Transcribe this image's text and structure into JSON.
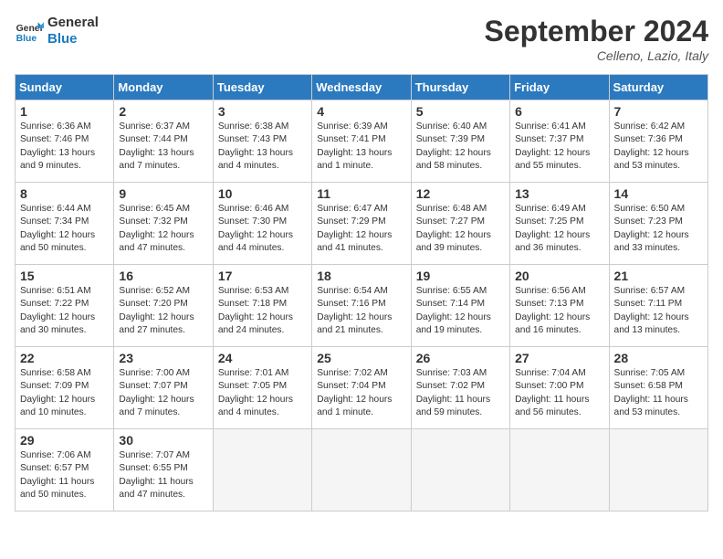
{
  "logo": {
    "line1": "General",
    "line2": "Blue"
  },
  "title": "September 2024",
  "location": "Celleno, Lazio, Italy",
  "days_of_week": [
    "Sunday",
    "Monday",
    "Tuesday",
    "Wednesday",
    "Thursday",
    "Friday",
    "Saturday"
  ],
  "weeks": [
    [
      {
        "num": "1",
        "sunrise": "6:36 AM",
        "sunset": "7:46 PM",
        "daylight": "13 hours and 9 minutes."
      },
      {
        "num": "2",
        "sunrise": "6:37 AM",
        "sunset": "7:44 PM",
        "daylight": "13 hours and 7 minutes."
      },
      {
        "num": "3",
        "sunrise": "6:38 AM",
        "sunset": "7:43 PM",
        "daylight": "13 hours and 4 minutes."
      },
      {
        "num": "4",
        "sunrise": "6:39 AM",
        "sunset": "7:41 PM",
        "daylight": "13 hours and 1 minute."
      },
      {
        "num": "5",
        "sunrise": "6:40 AM",
        "sunset": "7:39 PM",
        "daylight": "12 hours and 58 minutes."
      },
      {
        "num": "6",
        "sunrise": "6:41 AM",
        "sunset": "7:37 PM",
        "daylight": "12 hours and 55 minutes."
      },
      {
        "num": "7",
        "sunrise": "6:42 AM",
        "sunset": "7:36 PM",
        "daylight": "12 hours and 53 minutes."
      }
    ],
    [
      {
        "num": "8",
        "sunrise": "6:44 AM",
        "sunset": "7:34 PM",
        "daylight": "12 hours and 50 minutes."
      },
      {
        "num": "9",
        "sunrise": "6:45 AM",
        "sunset": "7:32 PM",
        "daylight": "12 hours and 47 minutes."
      },
      {
        "num": "10",
        "sunrise": "6:46 AM",
        "sunset": "7:30 PM",
        "daylight": "12 hours and 44 minutes."
      },
      {
        "num": "11",
        "sunrise": "6:47 AM",
        "sunset": "7:29 PM",
        "daylight": "12 hours and 41 minutes."
      },
      {
        "num": "12",
        "sunrise": "6:48 AM",
        "sunset": "7:27 PM",
        "daylight": "12 hours and 39 minutes."
      },
      {
        "num": "13",
        "sunrise": "6:49 AM",
        "sunset": "7:25 PM",
        "daylight": "12 hours and 36 minutes."
      },
      {
        "num": "14",
        "sunrise": "6:50 AM",
        "sunset": "7:23 PM",
        "daylight": "12 hours and 33 minutes."
      }
    ],
    [
      {
        "num": "15",
        "sunrise": "6:51 AM",
        "sunset": "7:22 PM",
        "daylight": "12 hours and 30 minutes."
      },
      {
        "num": "16",
        "sunrise": "6:52 AM",
        "sunset": "7:20 PM",
        "daylight": "12 hours and 27 minutes."
      },
      {
        "num": "17",
        "sunrise": "6:53 AM",
        "sunset": "7:18 PM",
        "daylight": "12 hours and 24 minutes."
      },
      {
        "num": "18",
        "sunrise": "6:54 AM",
        "sunset": "7:16 PM",
        "daylight": "12 hours and 21 minutes."
      },
      {
        "num": "19",
        "sunrise": "6:55 AM",
        "sunset": "7:14 PM",
        "daylight": "12 hours and 19 minutes."
      },
      {
        "num": "20",
        "sunrise": "6:56 AM",
        "sunset": "7:13 PM",
        "daylight": "12 hours and 16 minutes."
      },
      {
        "num": "21",
        "sunrise": "6:57 AM",
        "sunset": "7:11 PM",
        "daylight": "12 hours and 13 minutes."
      }
    ],
    [
      {
        "num": "22",
        "sunrise": "6:58 AM",
        "sunset": "7:09 PM",
        "daylight": "12 hours and 10 minutes."
      },
      {
        "num": "23",
        "sunrise": "7:00 AM",
        "sunset": "7:07 PM",
        "daylight": "12 hours and 7 minutes."
      },
      {
        "num": "24",
        "sunrise": "7:01 AM",
        "sunset": "7:05 PM",
        "daylight": "12 hours and 4 minutes."
      },
      {
        "num": "25",
        "sunrise": "7:02 AM",
        "sunset": "7:04 PM",
        "daylight": "12 hours and 1 minute."
      },
      {
        "num": "26",
        "sunrise": "7:03 AM",
        "sunset": "7:02 PM",
        "daylight": "11 hours and 59 minutes."
      },
      {
        "num": "27",
        "sunrise": "7:04 AM",
        "sunset": "7:00 PM",
        "daylight": "11 hours and 56 minutes."
      },
      {
        "num": "28",
        "sunrise": "7:05 AM",
        "sunset": "6:58 PM",
        "daylight": "11 hours and 53 minutes."
      }
    ],
    [
      {
        "num": "29",
        "sunrise": "7:06 AM",
        "sunset": "6:57 PM",
        "daylight": "11 hours and 50 minutes."
      },
      {
        "num": "30",
        "sunrise": "7:07 AM",
        "sunset": "6:55 PM",
        "daylight": "11 hours and 47 minutes."
      },
      null,
      null,
      null,
      null,
      null
    ]
  ]
}
